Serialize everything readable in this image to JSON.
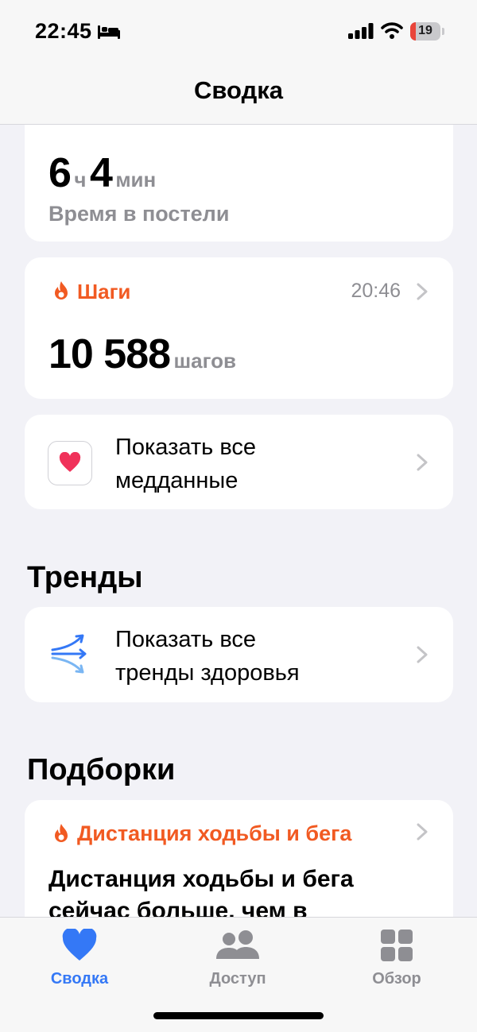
{
  "status_bar": {
    "time": "22:45",
    "battery_level": "19",
    "battery_fraction": 0.19,
    "icons": [
      "bed-icon",
      "signal-icon",
      "wifi-icon",
      "battery-icon"
    ]
  },
  "header": {
    "title": "Сводка"
  },
  "sleep_card": {
    "hours": "6",
    "hours_unit": "ч",
    "minutes": "4",
    "minutes_unit": "мин",
    "label": "Время в постели"
  },
  "steps_card": {
    "title": "Шаги",
    "time": "20:46",
    "value": "10 588",
    "unit": "шагов",
    "icon": "flame-icon"
  },
  "medical_card": {
    "label_line1": "Показать все",
    "label_line2": "медданные",
    "icon": "heart-app-icon"
  },
  "trends": {
    "section_title": "Тренды",
    "label_line1": "Показать все",
    "label_line2": "тренды здоровья",
    "icon": "trends-arrows-icon"
  },
  "collections": {
    "section_title": "Подборки",
    "card_title": "Дистанция ходьбы и бега",
    "card_body": "Дистанция ходьбы и бега сейчас больше, чем в"
  },
  "tab_bar": {
    "tabs": [
      {
        "label": "Сводка",
        "icon": "heart-icon",
        "active": true
      },
      {
        "label": "Доступ",
        "icon": "people-icon",
        "active": false
      },
      {
        "label": "Обзор",
        "icon": "grid-icon",
        "active": false
      }
    ]
  },
  "colors": {
    "accent_orange": "#f15a22",
    "active_tab_blue": "#3478f6",
    "inactive_gray": "#8e8e93",
    "background": "#f2f2f7"
  }
}
